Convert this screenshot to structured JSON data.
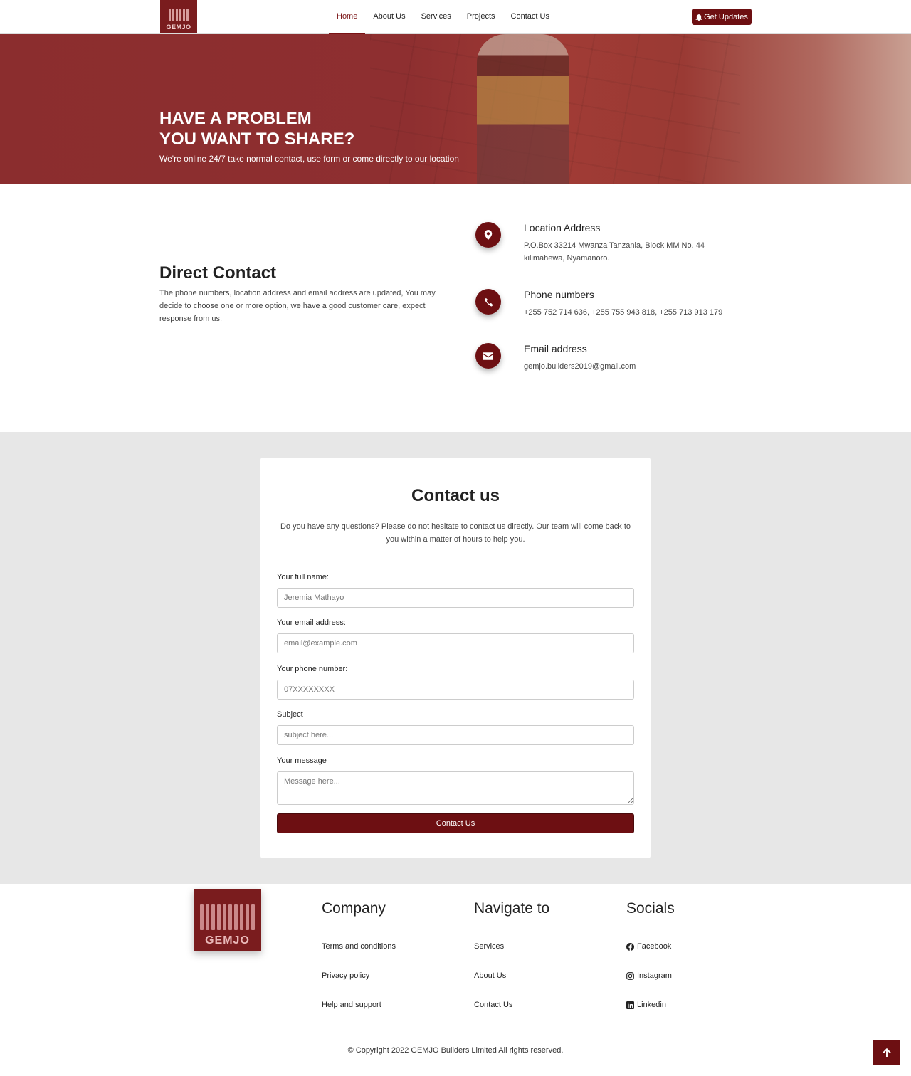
{
  "nav": {
    "logo_text": "GEMJO",
    "links": [
      "Home",
      "About Us",
      "Services",
      "Projects",
      "Contact Us"
    ],
    "active": "Home",
    "updates_label": "Get Updates"
  },
  "hero": {
    "title_line1": "HAVE A PROBLEM",
    "title_line2": "YOU WANT TO SHARE?",
    "subtitle": "We're online 24/7 take normal contact, use form or come directly to our location"
  },
  "direct": {
    "title": "Direct Contact",
    "text": "The phone numbers, location address and email address are updated, You may decide to choose one or more option, we have a good customer care, expect response from us."
  },
  "info": [
    {
      "icon": "location-pin-icon",
      "title": "Location Address",
      "text": "P.O.Box 33214 Mwanza Tanzania, Block MM No. 44 kilimahewa, Nyamanoro."
    },
    {
      "icon": "phone-icon",
      "title": "Phone numbers",
      "text": "+255 752 714 636, +255 755 943 818, +255 713 913 179"
    },
    {
      "icon": "envelope-icon",
      "title": "Email address",
      "text": "gemjo.builders2019@gmail.com"
    }
  ],
  "form": {
    "title": "Contact us",
    "description": "Do you have any questions? Please do not hesitate to contact us directly. Our team will come back to you within a matter of hours to help you.",
    "name_label": "Your full name:",
    "name_placeholder": "Jeremia Mathayo",
    "email_label": "Your email address:",
    "email_placeholder": "email@example.com",
    "phone_label": "Your phone number:",
    "phone_placeholder": "07XXXXXXXX",
    "subject_label": "Subject",
    "subject_placeholder": "subject here...",
    "message_label": "Your message",
    "message_placeholder": "Message here...",
    "submit_label": "Contact Us"
  },
  "footer": {
    "logo_text": "GEMJO",
    "company": {
      "title": "Company",
      "links": [
        "Terms and conditions",
        "Privacy policy",
        "Help and support"
      ]
    },
    "navigate": {
      "title": "Navigate to",
      "links": [
        "Services",
        "About Us",
        "Contact Us"
      ]
    },
    "socials": {
      "title": "Socials",
      "links": [
        "Facebook",
        "Instagram",
        "Linkedin"
      ]
    },
    "copyright": "© Copyright 2022 GEMJO Builders Limited All rights reserved."
  },
  "colors": {
    "brand": "#6d0f12",
    "hero": "#8b2d2e",
    "section_bg": "#e7e7e7"
  }
}
